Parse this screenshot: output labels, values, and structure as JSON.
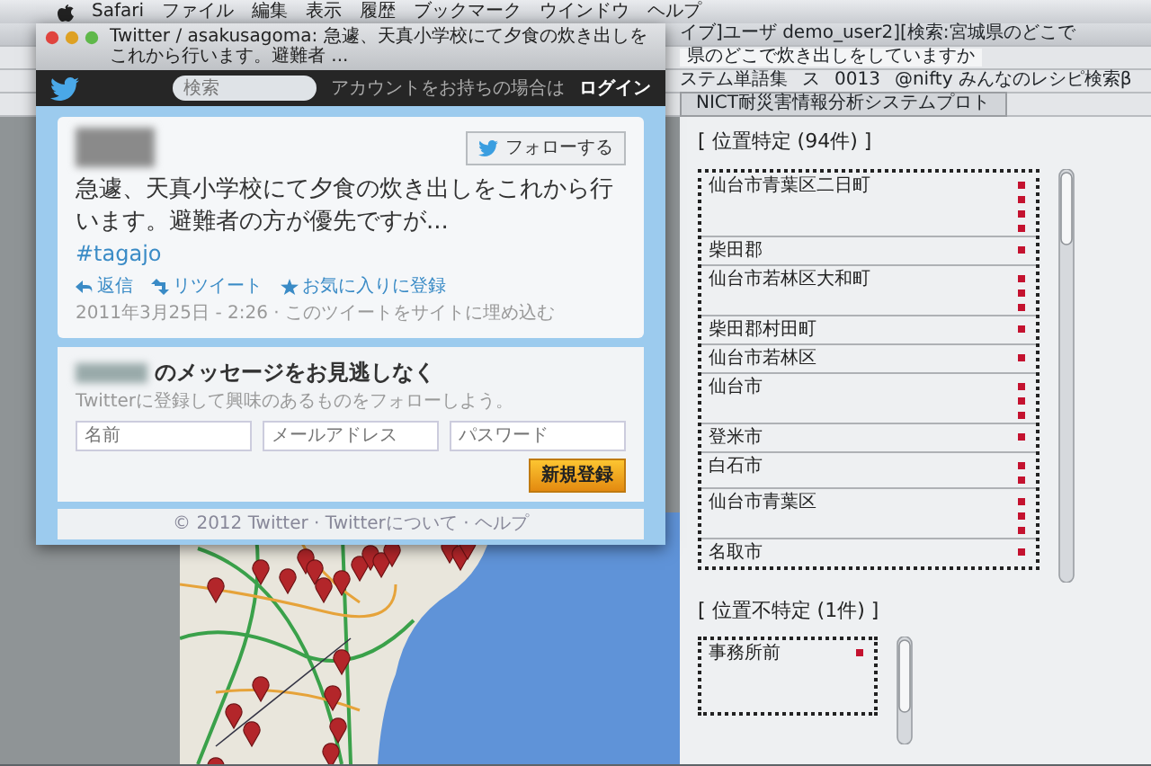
{
  "menu_bar": {
    "items": [
      "Safari",
      "ファイル",
      "編集",
      "表示",
      "履歴",
      "ブックマーク",
      "ウインドウ",
      "ヘルプ"
    ]
  },
  "back_window": {
    "title": "イブ]ユーザ demo_user2][検索:宮城県のどこで",
    "search_field": {
      "value": "県のどこで炊き出しをしていますか"
    },
    "bookmarks": [
      "ステム単語集",
      "ス",
      "0013",
      "@nifty みんなのレシピ検索β"
    ],
    "tabs": [
      {
        "label": "NICT耐災害情報分析システムプロト",
        "selected": true
      }
    ],
    "located_section": {
      "heading": "[ 位置特定 (94件) ]",
      "rows": [
        {
          "place": "仙台市青葉区二日町",
          "markers": [
            {
              "color": "#c4122f"
            },
            {
              "color": "#c4122f"
            },
            {
              "color": "#c4122f"
            },
            {
              "color": "#c4122f"
            }
          ]
        },
        {
          "place": "柴田郡",
          "markers": [
            {
              "color": "#c4122f"
            }
          ]
        },
        {
          "place": "仙台市若林区大和町",
          "markers": [
            {
              "color": "#c4122f"
            },
            {
              "color": "#c4122f"
            },
            {
              "color": "#c4122f"
            }
          ]
        },
        {
          "place": "柴田郡村田町",
          "markers": [
            {
              "color": "#c4122f"
            }
          ]
        },
        {
          "place": "仙台市若林区",
          "markers": [
            {
              "color": "#c4122f"
            }
          ]
        },
        {
          "place": "仙台市",
          "markers": [
            {
              "color": "#c4122f"
            },
            {
              "color": "#c4122f"
            },
            {
              "color": "#c4122f"
            }
          ]
        },
        {
          "place": "登米市",
          "markers": [
            {
              "color": "#c4122f"
            }
          ]
        },
        {
          "place": "白石市",
          "markers": [
            {
              "color": "#c4122f"
            },
            {
              "color": "#c4122f"
            }
          ]
        },
        {
          "place": "仙台市青葉区",
          "markers": [
            {
              "color": "#c4122f"
            },
            {
              "color": "#c4122f"
            },
            {
              "color": "#c4122f"
            }
          ]
        },
        {
          "place": "名取市",
          "markers": [
            {
              "color": "#c4122f"
            }
          ]
        }
      ]
    },
    "unlocated_section": {
      "heading": "[ 位置不特定 (1件) ]",
      "rows": [
        {
          "place": "事務所前",
          "markers": [
            {
              "color": "#c4122f"
            }
          ]
        }
      ]
    }
  },
  "front_window": {
    "title": "Twitter / asakusagoma: 急遽、天真小学校にて夕食の炊き出しをこれから行います。避難者 ...",
    "twitter_bar": {
      "search": {
        "placeholder": "検索"
      },
      "login_prompt": "アカウントをお持ちの場合は",
      "login_link": "ログイン"
    },
    "tweet": {
      "follow_button": "フォローする",
      "text": "急遽、天真小学校にて夕食の炊き出しをこれから行います。避難者の方が優先ですが...",
      "hashtag": "#tagajo",
      "actions": [
        {
          "kind": "reply",
          "label": "返信"
        },
        {
          "kind": "retweet",
          "label": "リツイート"
        },
        {
          "kind": "favorite",
          "label": "お気に入りに登録"
        }
      ],
      "timestamp": "2011年3月25日 - 2:26 · このツイートをサイトに埋め込む"
    },
    "signup": {
      "title": "のメッセージをお見逃しなく",
      "subtitle": "Twitterに登録して興味のあるものをフォローしよう。",
      "fields": [
        {
          "placeholder": "名前"
        },
        {
          "placeholder": "メールアドレス"
        },
        {
          "placeholder": "パスワード"
        }
      ],
      "button": "新規登録"
    },
    "footer": "© 2012 Twitter · Twitterについて · ヘルプ"
  }
}
